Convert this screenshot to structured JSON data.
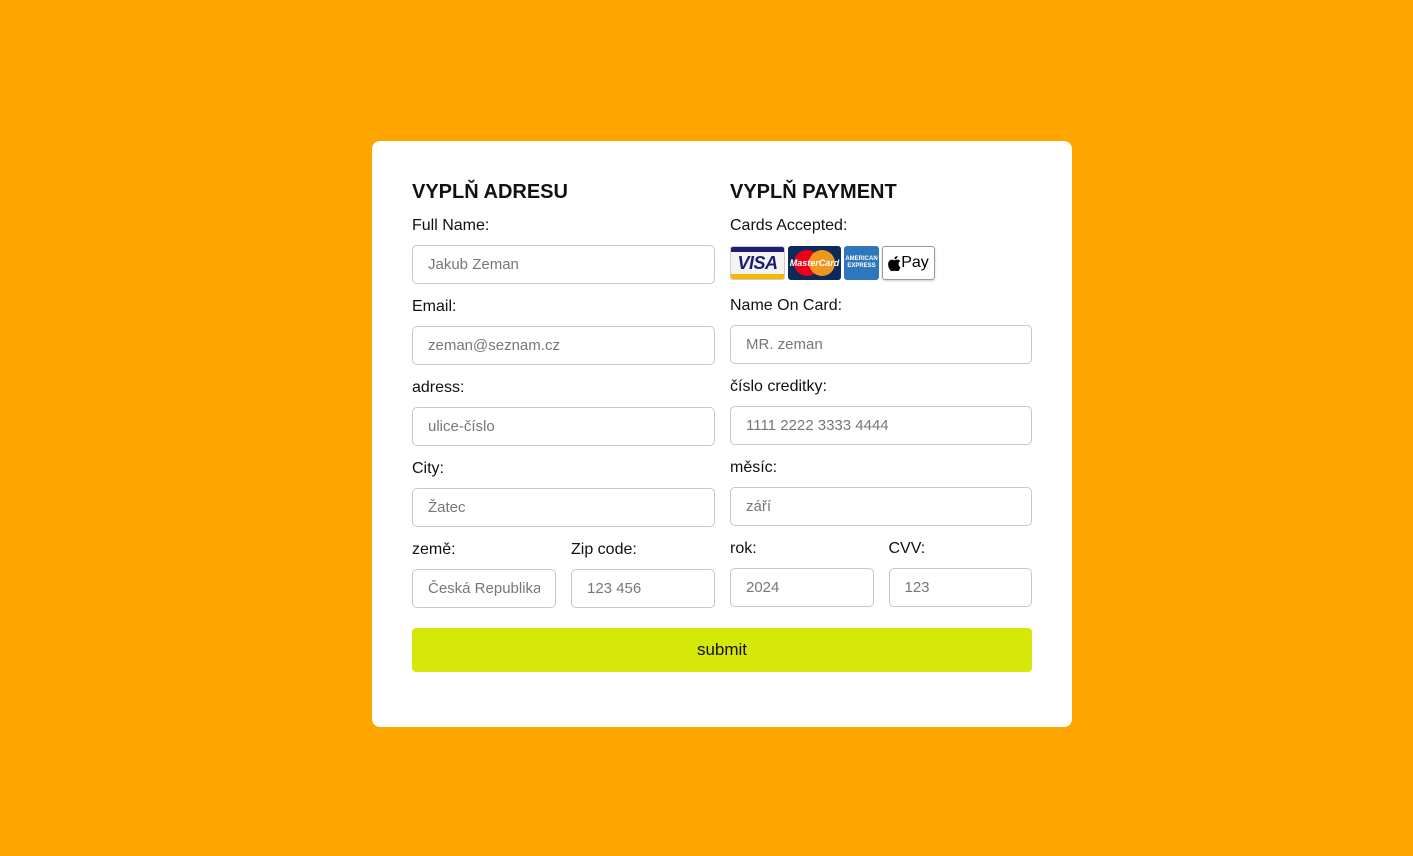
{
  "address": {
    "heading": "VYPLŇ ADRESU",
    "full_name": {
      "label": "Full Name:",
      "placeholder": "Jakub Zeman"
    },
    "email": {
      "label": "Email:",
      "placeholder": "zeman@seznam.cz"
    },
    "adress": {
      "label": "adress:",
      "placeholder": "ulice-číslo"
    },
    "city": {
      "label": "City:",
      "placeholder": "Žatec"
    },
    "country": {
      "label": "země:",
      "placeholder": "Česká Republika"
    },
    "zip": {
      "label": "Zip code:",
      "placeholder": "123 456"
    }
  },
  "payment": {
    "heading": "VYPLŇ PAYMENT",
    "cards_label": "Cards Accepted:",
    "cards": {
      "visa": "VISA",
      "mastercard": "MasterCard",
      "amex": "AMERICAN EXPRESS",
      "applepay": "Pay"
    },
    "name_on_card": {
      "label": "Name On Card:",
      "placeholder": "MR. zeman"
    },
    "card_number": {
      "label": "číslo creditky:",
      "placeholder": "1111 2222 3333 4444"
    },
    "month": {
      "label": "měsíc:",
      "placeholder": "září"
    },
    "year": {
      "label": "rok:",
      "placeholder": "2024"
    },
    "cvv": {
      "label": "CVV:",
      "placeholder": "123"
    }
  },
  "submit_label": "submit",
  "colors": {
    "background": "#ffa500",
    "submit": "#d6e80a"
  }
}
